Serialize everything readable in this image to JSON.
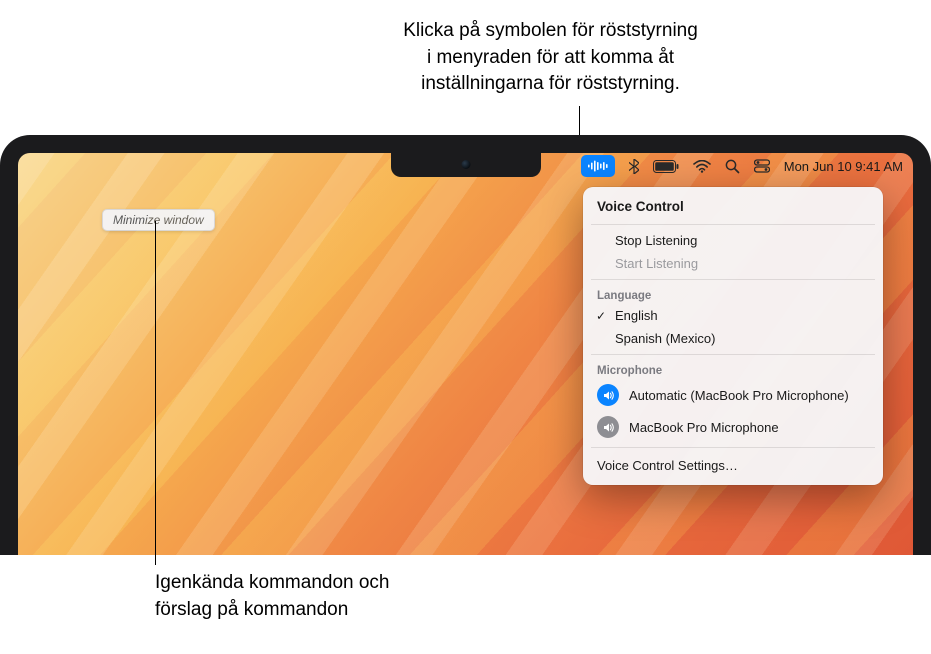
{
  "annotations": {
    "top": "Klicka på symbolen för röststyrning\ni menyraden för att komma åt\ninställningarna för röststyrning.",
    "bottom": "Igenkända kommandon och\nförslag på kommandon"
  },
  "menubar": {
    "clock": "Mon Jun 10  9:41 AM"
  },
  "hint": {
    "text": "Minimize window"
  },
  "panel": {
    "title": "Voice Control",
    "stop_listening": "Stop Listening",
    "start_listening": "Start Listening",
    "language_heading": "Language",
    "languages": {
      "english": "English",
      "spanish": "Spanish (Mexico)"
    },
    "microphone_heading": "Microphone",
    "mics": {
      "auto": "Automatic (MacBook Pro Microphone)",
      "mbp": "MacBook Pro Microphone"
    },
    "settings": "Voice Control Settings…"
  }
}
